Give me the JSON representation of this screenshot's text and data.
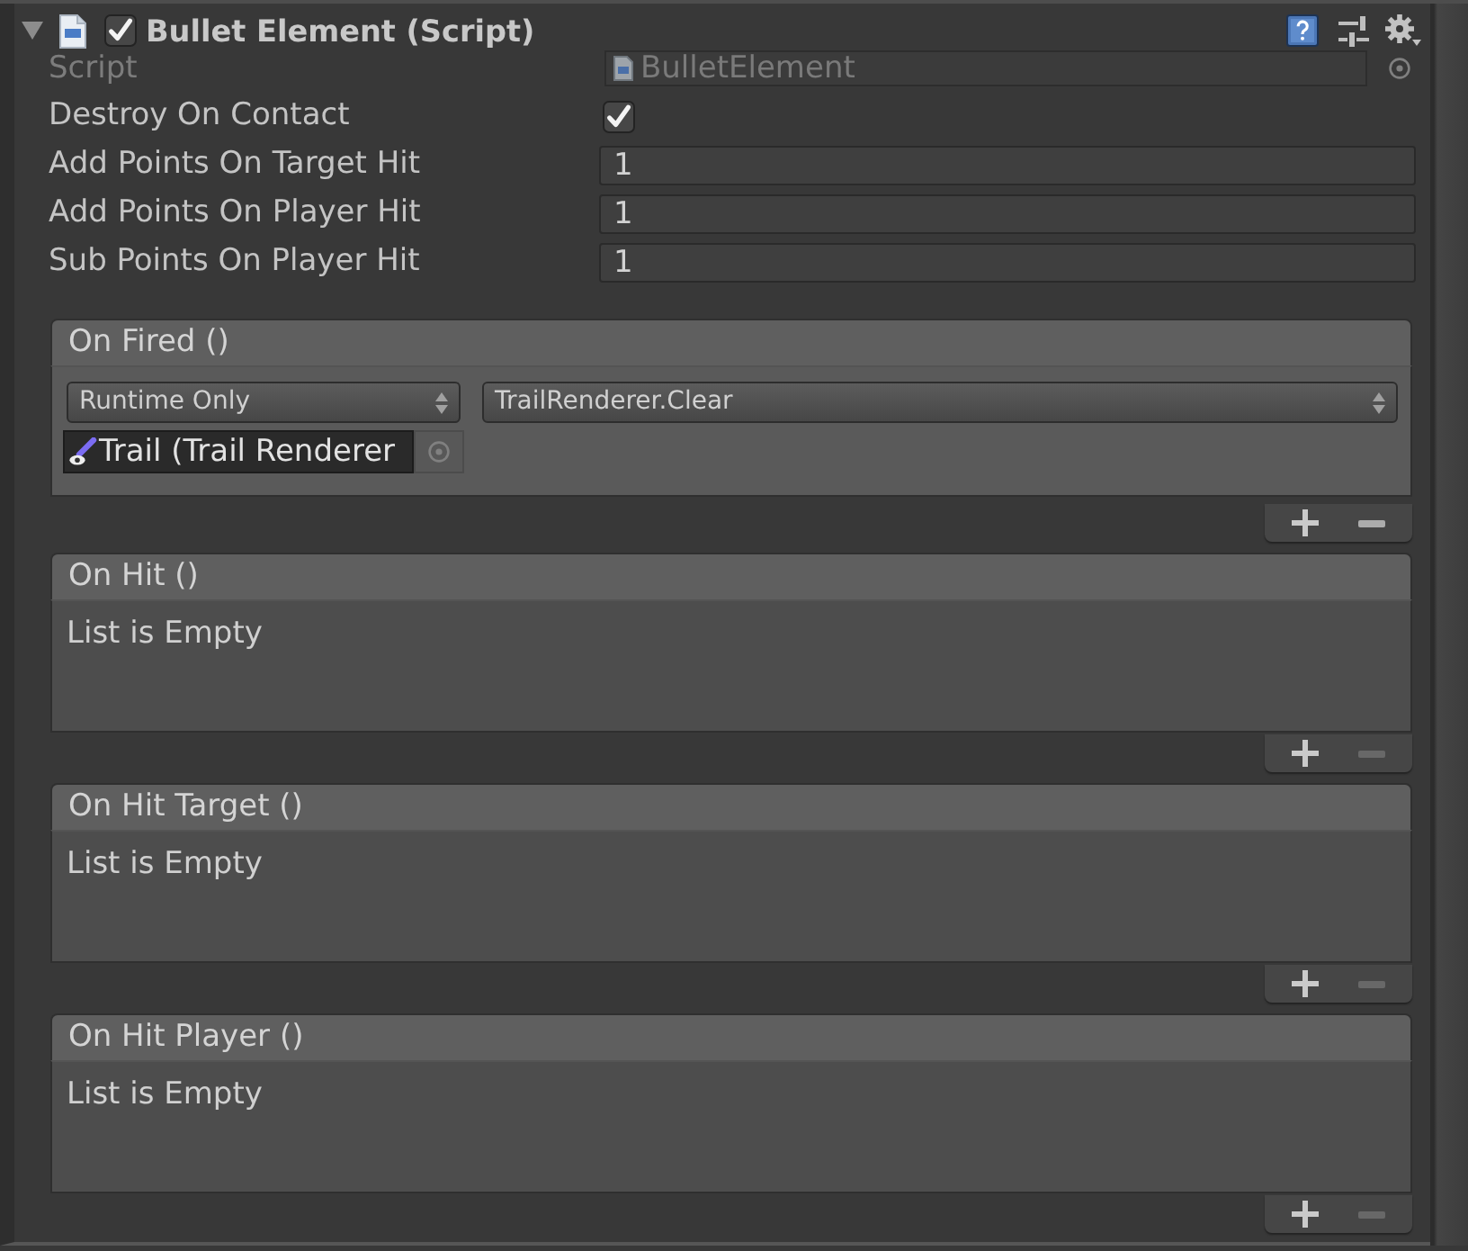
{
  "component": {
    "title": "Bullet Element (Script)",
    "expanded": true,
    "enabled": true
  },
  "script": {
    "label": "Script",
    "value": "BulletElement",
    "disabled": true
  },
  "properties": [
    {
      "kind": "checkbox",
      "label": "Destroy On Contact",
      "checked": true
    },
    {
      "kind": "number",
      "label": "Add Points On Target Hit",
      "value": "1"
    },
    {
      "kind": "number",
      "label": "Add Points On Player Hit",
      "value": "1"
    },
    {
      "kind": "number",
      "label": "Sub Points On Player Hit",
      "value": "1"
    }
  ],
  "events": [
    {
      "title": "On Fired ()",
      "listeners": [
        {
          "mode": "Runtime Only",
          "function": "TrailRenderer.Clear",
          "target": "Trail (Trail Renderer"
        }
      ],
      "remove_disabled": false
    },
    {
      "title": "On Hit ()",
      "empty_text": "List is Empty",
      "remove_disabled": true
    },
    {
      "title": "On Hit Target ()",
      "empty_text": "List is Empty",
      "remove_disabled": true
    },
    {
      "title": "On Hit Player ()",
      "empty_text": "List is Empty",
      "remove_disabled": true
    }
  ]
}
